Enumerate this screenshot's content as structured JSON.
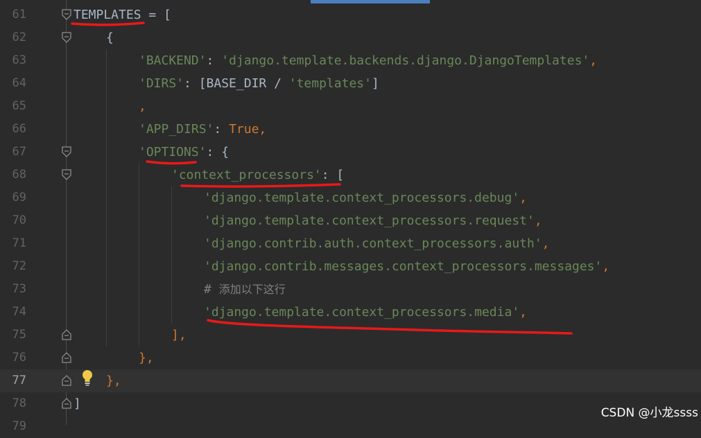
{
  "editor": {
    "lines": [
      {
        "number": "61",
        "indent": 0,
        "fold": "open",
        "tokens": [
          {
            "text": "TEMPLATES",
            "kind": "plain"
          },
          {
            "text": " = [",
            "kind": "plain"
          }
        ]
      },
      {
        "number": "62",
        "indent": 1,
        "fold": "open",
        "tokens": [
          {
            "text": "{",
            "kind": "plain"
          }
        ]
      },
      {
        "number": "63",
        "indent": 2,
        "fold": "",
        "tokens": [
          {
            "text": "'BACKEND'",
            "kind": "string"
          },
          {
            "text": ": ",
            "kind": "plain"
          },
          {
            "text": "'django.template.backends.django.DjangoTemplates'",
            "kind": "string"
          },
          {
            "text": ",",
            "kind": "keyword"
          }
        ]
      },
      {
        "number": "64",
        "indent": 2,
        "fold": "",
        "tokens": [
          {
            "text": "'DIRS'",
            "kind": "string"
          },
          {
            "text": ": [BASE_DIR / ",
            "kind": "plain"
          },
          {
            "text": "'templates'",
            "kind": "string"
          },
          {
            "text": "]",
            "kind": "plain"
          }
        ]
      },
      {
        "number": "65",
        "indent": 2,
        "fold": "",
        "tokens": [
          {
            "text": ",",
            "kind": "keyword"
          }
        ]
      },
      {
        "number": "66",
        "indent": 2,
        "fold": "",
        "tokens": [
          {
            "text": "'APP_DIRS'",
            "kind": "string"
          },
          {
            "text": ": ",
            "kind": "plain"
          },
          {
            "text": "True",
            "kind": "keyword"
          },
          {
            "text": ",",
            "kind": "keyword"
          }
        ]
      },
      {
        "number": "67",
        "indent": 2,
        "fold": "open",
        "tokens": [
          {
            "text": "'OPTIONS'",
            "kind": "string"
          },
          {
            "text": ": {",
            "kind": "plain"
          }
        ]
      },
      {
        "number": "68",
        "indent": 3,
        "fold": "open",
        "tokens": [
          {
            "text": "'context_processors'",
            "kind": "string"
          },
          {
            "text": ": [",
            "kind": "plain"
          }
        ]
      },
      {
        "number": "69",
        "indent": 4,
        "fold": "",
        "tokens": [
          {
            "text": "'django.template.context_processors.debug'",
            "kind": "string"
          },
          {
            "text": ",",
            "kind": "keyword"
          }
        ]
      },
      {
        "number": "70",
        "indent": 4,
        "fold": "",
        "tokens": [
          {
            "text": "'django.template.context_processors.request'",
            "kind": "string"
          },
          {
            "text": ",",
            "kind": "keyword"
          }
        ]
      },
      {
        "number": "71",
        "indent": 4,
        "fold": "",
        "tokens": [
          {
            "text": "'django.contrib.auth.context_processors.auth'",
            "kind": "string"
          },
          {
            "text": ",",
            "kind": "keyword"
          }
        ]
      },
      {
        "number": "72",
        "indent": 4,
        "fold": "",
        "tokens": [
          {
            "text": "'django.contrib.messages.context_processors.messages'",
            "kind": "string"
          },
          {
            "text": ",",
            "kind": "keyword"
          }
        ]
      },
      {
        "number": "73",
        "indent": 4,
        "fold": "",
        "tokens": [
          {
            "text": "# ",
            "kind": "comment"
          },
          {
            "text": "添加以下这行",
            "kind": "comment-cjk"
          }
        ]
      },
      {
        "number": "74",
        "indent": 4,
        "fold": "",
        "tokens": [
          {
            "text": "'django.template.context_processors.media'",
            "kind": "string"
          },
          {
            "text": ",",
            "kind": "keyword"
          }
        ]
      },
      {
        "number": "75",
        "indent": 3,
        "fold": "close",
        "tokens": [
          {
            "text": "],",
            "kind": "keyword"
          }
        ]
      },
      {
        "number": "76",
        "indent": 2,
        "fold": "close",
        "tokens": [
          {
            "text": "},",
            "kind": "keyword"
          }
        ]
      },
      {
        "number": "77",
        "indent": 1,
        "fold": "close",
        "current": true,
        "bulb": true,
        "tokens": [
          {
            "text": "},",
            "kind": "keyword"
          }
        ]
      },
      {
        "number": "78",
        "indent": 0,
        "fold": "close",
        "tokens": [
          {
            "text": "]",
            "kind": "plain"
          }
        ]
      },
      {
        "number": "79",
        "indent": 0,
        "fold": "",
        "tokens": []
      }
    ]
  },
  "colors": {
    "background": "#2b2b2b",
    "string": "#6a8759",
    "keyword": "#cc7832",
    "plain": "#a9b7c6",
    "comment": "#808080",
    "annotation": "#e8191a",
    "line_number": "#606366"
  },
  "watermark": {
    "text": "CSDN @小龙ssss"
  }
}
